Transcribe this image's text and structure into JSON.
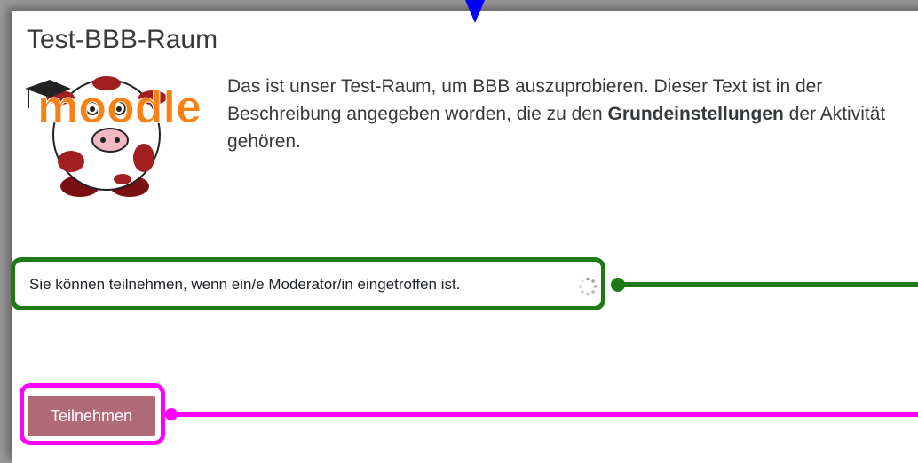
{
  "page": {
    "title": "Test-BBB-Raum",
    "description_pre": "Das ist unser Test-Raum, um BBB auszuprobieren. Dieser Text ist in der Beschreibung angegeben worden, die zu den ",
    "description_bold": "Grundeinstellungen",
    "description_post": " der Aktivität gehören."
  },
  "status": {
    "text": "Sie können teilnehmen, wenn ein/e Moderator/in eingetroffen ist."
  },
  "join": {
    "label": "Teilnehmen"
  },
  "logo": {
    "text": "moodle"
  },
  "colors": {
    "green_callout": "#1b7a12",
    "magenta_callout": "#ff00ff",
    "blue_arrow": "#0000ff",
    "button": "#b06a75",
    "moodle_orange": "#f98012"
  }
}
